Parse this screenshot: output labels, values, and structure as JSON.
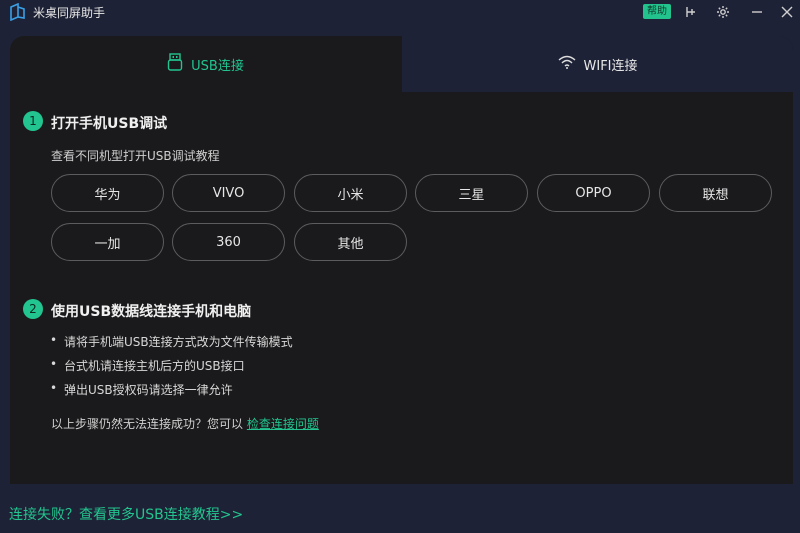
{
  "app": {
    "title": "米桌同屏助手",
    "help_label": "帮助"
  },
  "tabs": [
    {
      "label": "USB连接",
      "icon": "usb-icon",
      "active": true
    },
    {
      "label": "WIFI连接",
      "icon": "wifi-icon",
      "active": false
    }
  ],
  "step1": {
    "number": "1",
    "title": "打开手机USB调试",
    "subtitle": "查看不同机型打开USB调试教程",
    "brands": [
      "华为",
      "VIVO",
      "小米",
      "三星",
      "OPPO",
      "联想",
      "一加",
      "360",
      "其他"
    ]
  },
  "step2": {
    "number": "2",
    "title": "使用USB数据线连接手机和电脑",
    "bullets": [
      "请将手机端USB连接方式改为文件传输模式",
      "台式机请连接主机后方的USB接口",
      "弹出USB授权码请选择一律允许"
    ],
    "note_prefix": "以上步骤仍然无法连接成功？您可以",
    "note_link": "检查连接问题"
  },
  "footer": {
    "link": "连接失败？查看更多USB连接教程>>"
  },
  "colors": {
    "accent": "#22c58f",
    "background": "#1e2236",
    "panel": "#1a1a1c"
  }
}
